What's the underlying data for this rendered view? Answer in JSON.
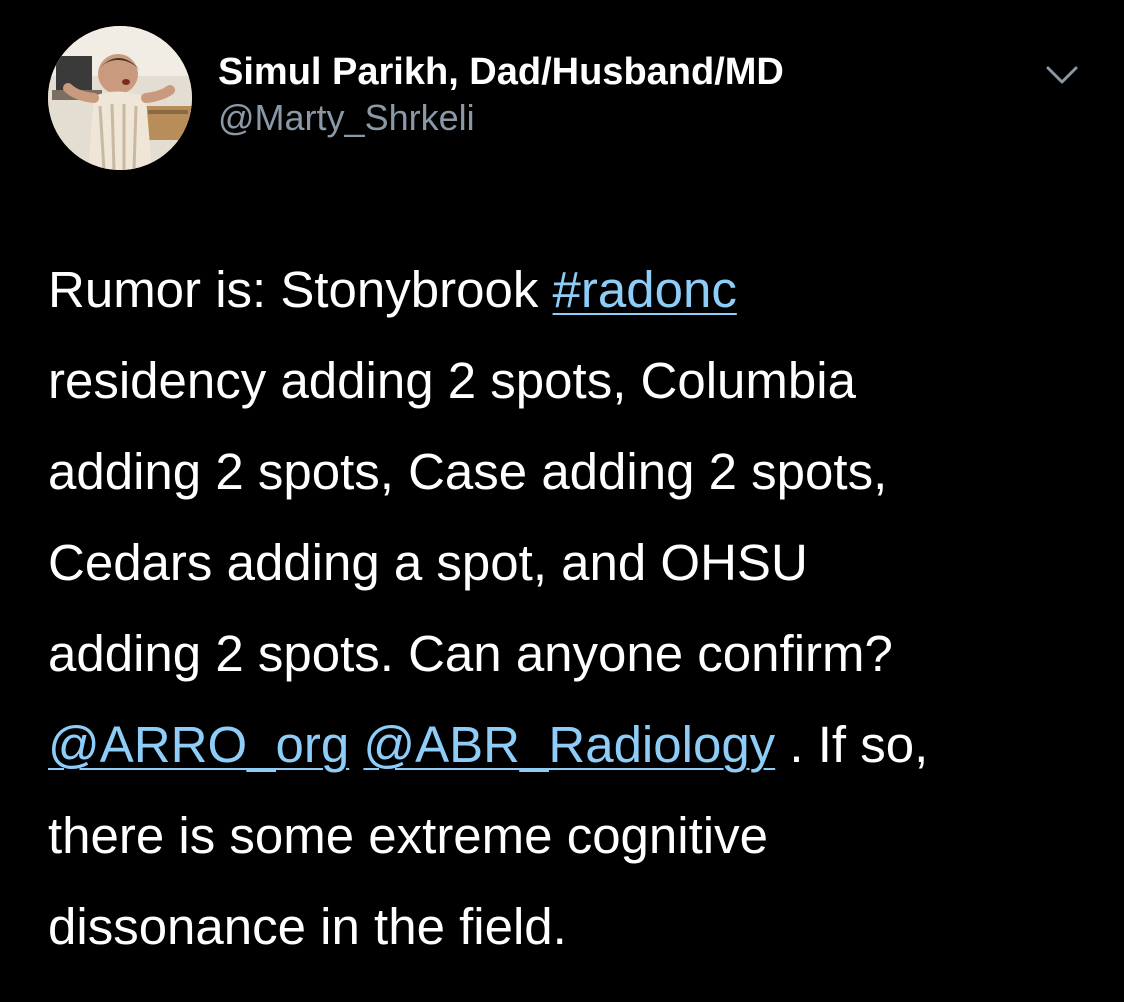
{
  "author": {
    "display_name": "Simul Parikh, Dad/Husband/MD",
    "handle": "@Marty_Shrkeli"
  },
  "icons": {
    "avatar": "avatar-photo",
    "menu": "chevron-down-icon"
  },
  "colors": {
    "background": "#000000",
    "text": "#ffffff",
    "secondary_text": "#8b98a5",
    "link": "#8ecdf8"
  },
  "tweet": {
    "line1_text": "Rumor is: Stonybrook ",
    "hashtag": "#radonc",
    "line2": "residency adding 2 spots, Columbia",
    "line3": "adding 2 spots, Case adding 2 spots,",
    "line4": "Cedars adding a spot, and OHSU",
    "line5": "adding 2 spots. Can anyone confirm?",
    "mention1": "@ARRO_org",
    "mention2": "@ABR_Radiology",
    "line6_tail": " . If so,",
    "line7": "there is some extreme cognitive",
    "line8": "dissonance in the field."
  }
}
